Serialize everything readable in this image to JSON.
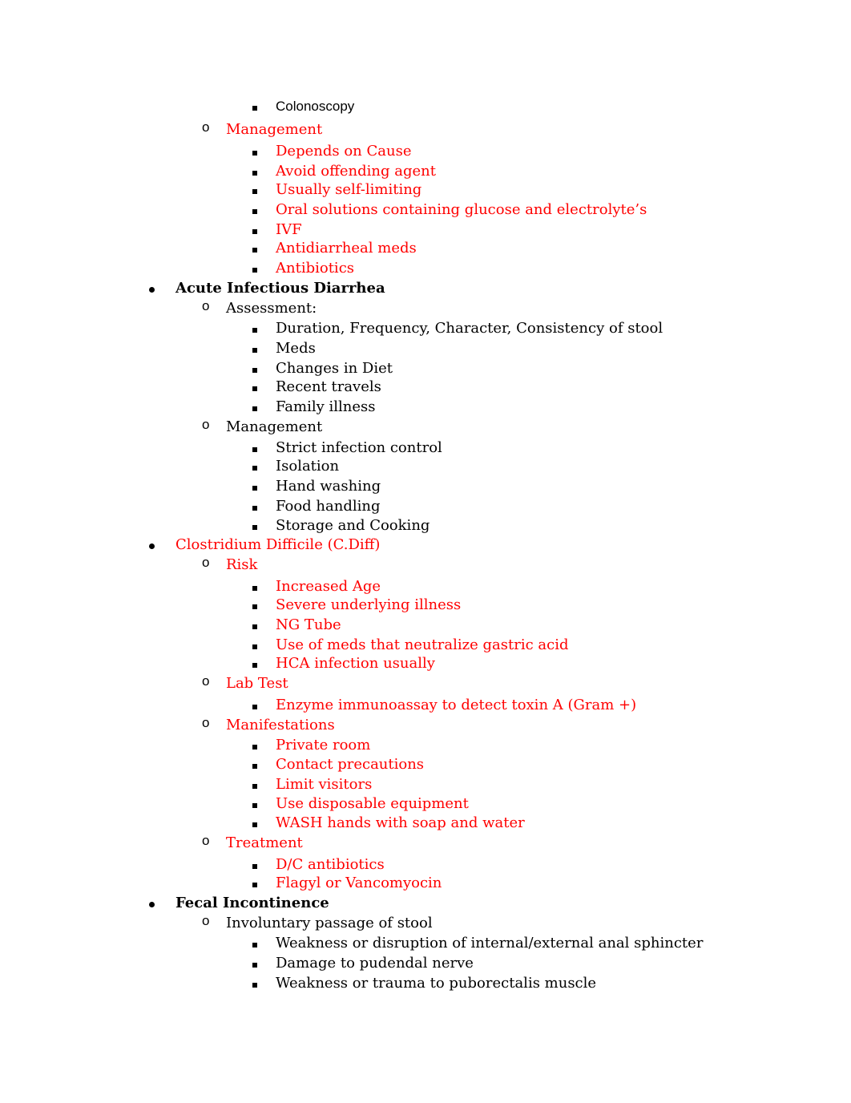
{
  "document": {
    "lines": [
      {
        "level": 3,
        "text": "Colonoscopy",
        "color": "black",
        "bold": false,
        "sans": true
      },
      {
        "level": 2,
        "text": "Management",
        "color": "red"
      },
      {
        "level": 3,
        "text": "Depends on Cause",
        "color": "red"
      },
      {
        "level": 3,
        "text": "Avoid offending agent",
        "color": "red"
      },
      {
        "level": 3,
        "text": "Usually self-limiting",
        "color": "red"
      },
      {
        "level": 3,
        "text": "Oral solutions containing glucose and electrolyte’s",
        "color": "red"
      },
      {
        "level": 3,
        "text": "IVF",
        "color": "red"
      },
      {
        "level": 3,
        "text": "Antidiarrheal meds",
        "color": "red"
      },
      {
        "level": 3,
        "text": "Antibiotics",
        "color": "red"
      },
      {
        "level": 1,
        "text": "Acute Infectious Diarrhea",
        "color": "black",
        "bold": true
      },
      {
        "level": 2,
        "text": "Assessment:",
        "color": "black"
      },
      {
        "level": 3,
        "text": "Duration, Frequency, Character, Consistency of stool",
        "color": "black"
      },
      {
        "level": 3,
        "text": "Meds",
        "color": "black"
      },
      {
        "level": 3,
        "text": "Changes in Diet",
        "color": "black"
      },
      {
        "level": 3,
        "text": "Recent travels",
        "color": "black"
      },
      {
        "level": 3,
        "text": "Family illness",
        "color": "black"
      },
      {
        "level": 2,
        "text": "Management",
        "color": "black"
      },
      {
        "level": 3,
        "text": "Strict infection control",
        "color": "black"
      },
      {
        "level": 3,
        "text": "Isolation",
        "color": "black"
      },
      {
        "level": 3,
        "text": "Hand washing",
        "color": "black"
      },
      {
        "level": 3,
        "text": "Food handling",
        "color": "black"
      },
      {
        "level": 3,
        "text": "Storage and Cooking",
        "color": "black"
      },
      {
        "level": 1,
        "text": "Clostridium Difficile (C.Diff)",
        "color": "red"
      },
      {
        "level": 2,
        "text": "Risk",
        "color": "red"
      },
      {
        "level": 3,
        "text": "Increased Age",
        "color": "red"
      },
      {
        "level": 3,
        "text": "Severe underlying illness",
        "color": "red"
      },
      {
        "level": 3,
        "text": "NG Tube",
        "color": "red"
      },
      {
        "level": 3,
        "text": "Use of meds that neutralize gastric acid",
        "color": "red"
      },
      {
        "level": 3,
        "text": "HCA infection usually",
        "color": "red"
      },
      {
        "level": 2,
        "text": "Lab Test",
        "color": "red"
      },
      {
        "level": 3,
        "text": "Enzyme immunoassay to detect toxin A (Gram +)",
        "color": "red"
      },
      {
        "level": 2,
        "text": "Manifestations",
        "color": "red"
      },
      {
        "level": 3,
        "text": "Private room",
        "color": "red"
      },
      {
        "level": 3,
        "text": "Contact precautions",
        "color": "red"
      },
      {
        "level": 3,
        "text": "Limit visitors",
        "color": "red"
      },
      {
        "level": 3,
        "text": "Use disposable equipment",
        "color": "red"
      },
      {
        "level": 3,
        "text": "WASH hands with soap and water",
        "color": "red"
      },
      {
        "level": 2,
        "text": "Treatment",
        "color": "red"
      },
      {
        "level": 3,
        "text": "D/C antibiotics",
        "color": "red"
      },
      {
        "level": 3,
        "text": "Flagyl or Vancomyocin",
        "color": "red"
      },
      {
        "level": 1,
        "text": "Fecal Incontinence",
        "color": "black",
        "bold": true
      },
      {
        "level": 2,
        "text": "Involuntary passage of stool",
        "color": "black"
      },
      {
        "level": 3,
        "text": "Weakness or disruption of internal/external anal sphincter",
        "color": "black"
      },
      {
        "level": 3,
        "text": "Damage to pudendal nerve",
        "color": "black"
      },
      {
        "level": 3,
        "text": "Weakness or trauma to puborectalis muscle",
        "color": "black"
      }
    ],
    "markers": {
      "level1": "bullet",
      "level2": "o",
      "level3": "square"
    },
    "colors": {
      "red": "#ff0000",
      "black": "#000000"
    }
  }
}
